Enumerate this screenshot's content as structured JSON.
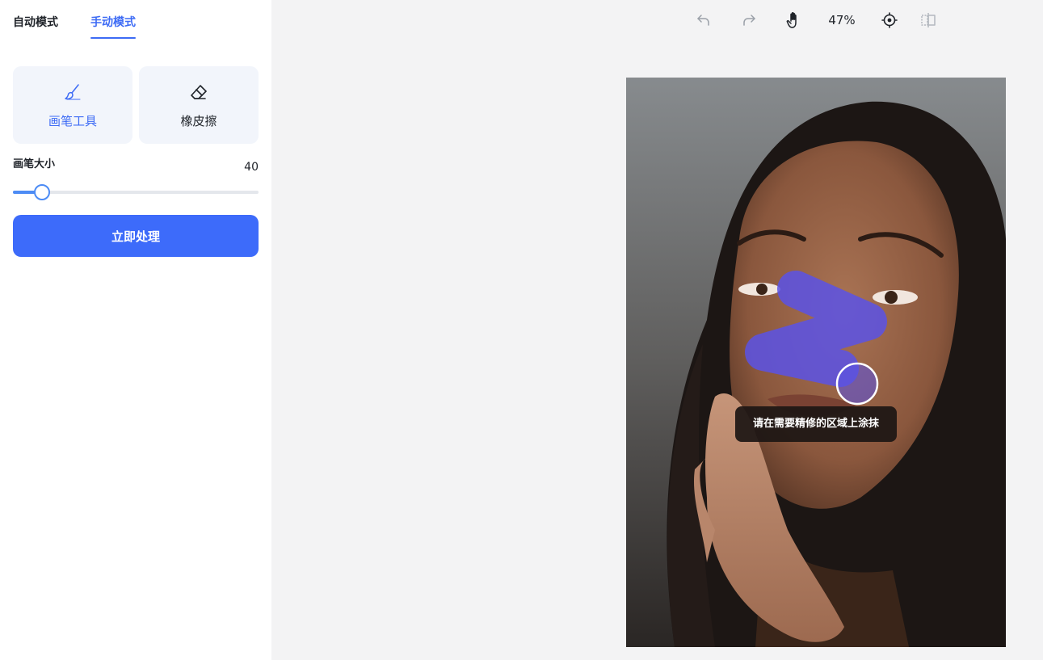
{
  "sidebar": {
    "tabs": [
      {
        "label": "自动模式",
        "active": false
      },
      {
        "label": "手动模式",
        "active": true
      }
    ],
    "tools": {
      "brush": {
        "label": "画笔工具",
        "icon": "brush-icon",
        "active": true
      },
      "eraser": {
        "label": "橡皮擦",
        "icon": "eraser-icon",
        "active": false
      }
    },
    "brush_size": {
      "label": "画笔大小",
      "value": "40",
      "fraction": 0.12
    },
    "process_button": "立即处理"
  },
  "toolbar": {
    "icons": [
      "undo-icon",
      "redo-icon",
      "hand-icon",
      "crosshair-icon",
      "compare-icon"
    ],
    "zoom": "47%"
  },
  "canvas": {
    "tooltip": "请在需要精修的区域上涂抹"
  },
  "colors": {
    "accent": "#3d6bf5",
    "button": "#3d6bfa",
    "slider": "#4d8cf5",
    "mask": "#5a52e6"
  }
}
